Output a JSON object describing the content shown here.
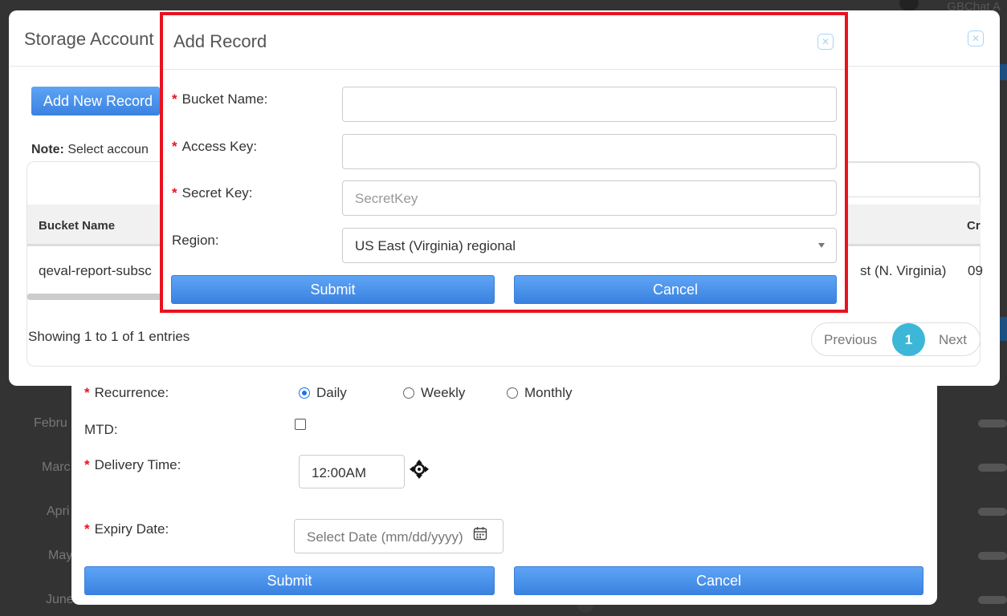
{
  "background": {
    "top_right_text": "GBChat A",
    "months": [
      "Febru",
      "Marc",
      "Apri",
      "May",
      "June"
    ]
  },
  "subscription_form": {
    "recurrence_label": "Recurrence:",
    "recurrence_options": [
      "Daily",
      "Weekly",
      "Monthly"
    ],
    "recurrence_selected": "Daily",
    "mtd_label": "MTD:",
    "delivery_time_label": "Delivery Time:",
    "delivery_time_value": "12:00AM",
    "expiry_date_label": "Expiry Date:",
    "expiry_date_placeholder": "Select Date (mm/dd/yyyy)",
    "submit_label": "Submit",
    "cancel_label": "Cancel"
  },
  "storage_account": {
    "title": "Storage Account",
    "add_button_label": "Add New Record",
    "note_bold": "Note:",
    "note_text": " Select accoun",
    "columns": [
      "Bucket Name",
      "Cr"
    ],
    "rows": [
      {
        "bucket_name": "qeval-report-subsc",
        "region_tail": "st (N. Virginia)",
        "created_tail": "09"
      }
    ],
    "info_text": "Showing 1 to 1 of 1 entries",
    "pager": {
      "previous": "Previous",
      "page": "1",
      "next": "Next"
    }
  },
  "add_record": {
    "title": "Add Record",
    "bucket_name_label": "Bucket Name:",
    "bucket_name_value": "",
    "access_key_label": "Access Key:",
    "access_key_value": "",
    "secret_key_label": "Secret Key:",
    "secret_key_placeholder": "SecretKey",
    "region_label": "Region:",
    "region_value": "US East (Virginia) regional",
    "required_mark": "*",
    "submit_label": "Submit",
    "cancel_label": "Cancel"
  },
  "colors": {
    "highlight_border": "#e8131f",
    "primary_button": "#4a90e2",
    "pager_active": "#3cb7d8"
  }
}
